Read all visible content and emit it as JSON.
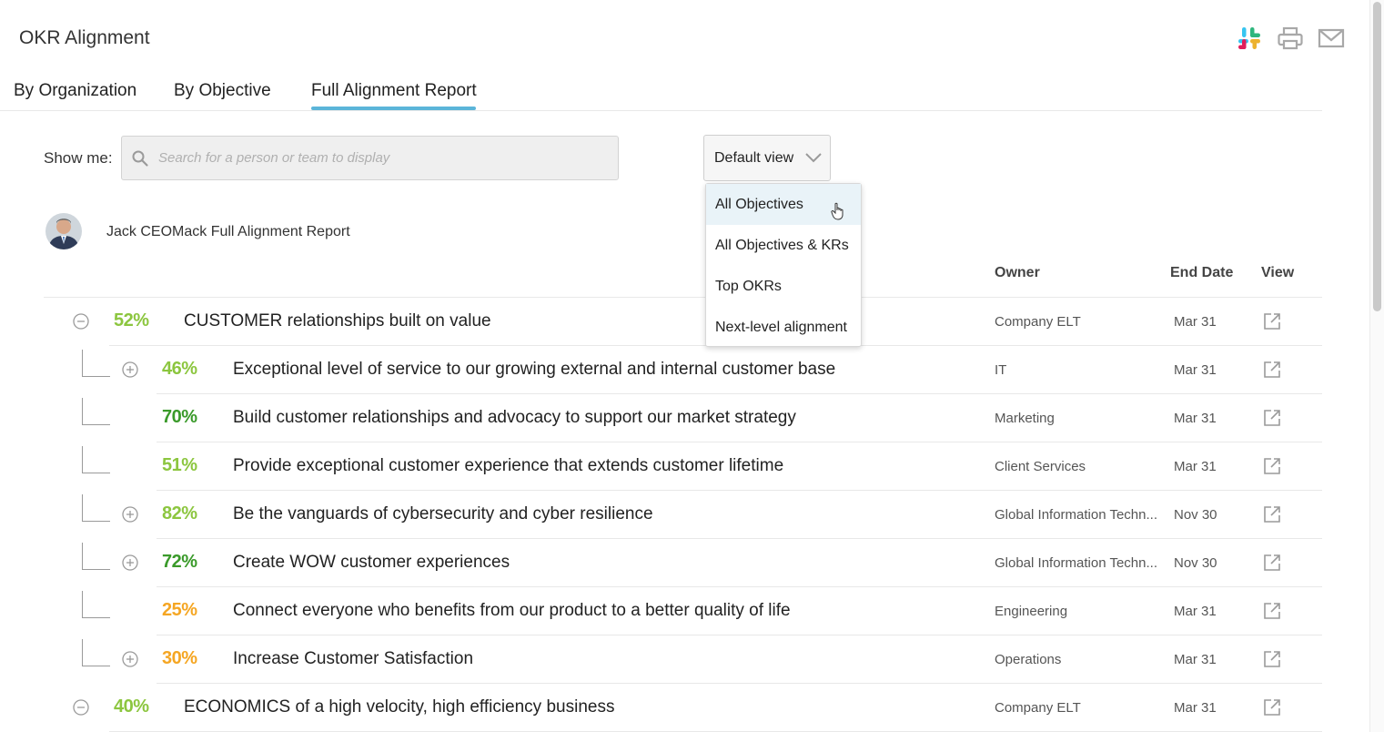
{
  "header": {
    "title": "OKR Alignment",
    "icons": [
      "slack-icon",
      "printer-icon",
      "mail-icon"
    ]
  },
  "tabs": [
    {
      "label": "By Organization",
      "active": false
    },
    {
      "label": "By Objective",
      "active": false
    },
    {
      "label": "Full Alignment Report",
      "active": true
    }
  ],
  "filter": {
    "show_me_label": "Show me:",
    "search_placeholder": "Search for a person or team to display",
    "view_select_label": "Default view",
    "view_options": [
      "All Objectives",
      "All Objectives & KRs",
      "Top OKRs",
      "Next-level alignment"
    ],
    "hovered_option": "All Objectives"
  },
  "report": {
    "title": "Jack CEOMack Full Alignment Report",
    "columns": {
      "owner": "Owner",
      "end_date": "End Date",
      "view": "View"
    },
    "rows": [
      {
        "level": 0,
        "toggle": "collapse",
        "pct": "52%",
        "title": "CUSTOMER relationships built on value",
        "owner": "Company ELT",
        "end_date": "Mar 31"
      },
      {
        "level": 1,
        "toggle": "expand",
        "pct": "46%",
        "title": "Exceptional level of service to our growing external and internal customer base",
        "owner": "IT",
        "end_date": "Mar 31"
      },
      {
        "level": 1,
        "toggle": "none",
        "pct": "70%",
        "title": "Build customer relationships and advocacy to support our market strategy",
        "owner": "Marketing",
        "end_date": "Mar 31"
      },
      {
        "level": 1,
        "toggle": "none",
        "pct": "51%",
        "title": "Provide exceptional customer experience that extends customer lifetime",
        "owner": "Client Services",
        "end_date": "Mar 31"
      },
      {
        "level": 1,
        "toggle": "expand",
        "pct": "82%",
        "title": "Be the vanguards of cybersecurity and cyber resilience",
        "owner": "Global Information Techn...",
        "end_date": "Nov 30"
      },
      {
        "level": 1,
        "toggle": "expand",
        "pct": "72%",
        "title": "Create WOW customer experiences",
        "owner": "Global Information Techn...",
        "end_date": "Nov 30"
      },
      {
        "level": 1,
        "toggle": "none",
        "pct": "25%",
        "title": "Connect everyone who benefits from our product to a better quality of life",
        "owner": "Engineering",
        "end_date": "Mar 31"
      },
      {
        "level": 1,
        "toggle": "expand",
        "pct": "30%",
        "title": "Increase Customer Satisfaction",
        "owner": "Operations",
        "end_date": "Mar 31"
      },
      {
        "level": 0,
        "toggle": "collapse",
        "pct": "40%",
        "title": "ECONOMICS of a high velocity, high efficiency business",
        "owner": "Company ELT",
        "end_date": "Mar 31"
      }
    ]
  },
  "colors": {
    "tab_underline": "#5bb5d9",
    "pct_light_green": "#8cc63f",
    "pct_dark_green": "#3a9a2a",
    "pct_orange": "#f5a623"
  }
}
